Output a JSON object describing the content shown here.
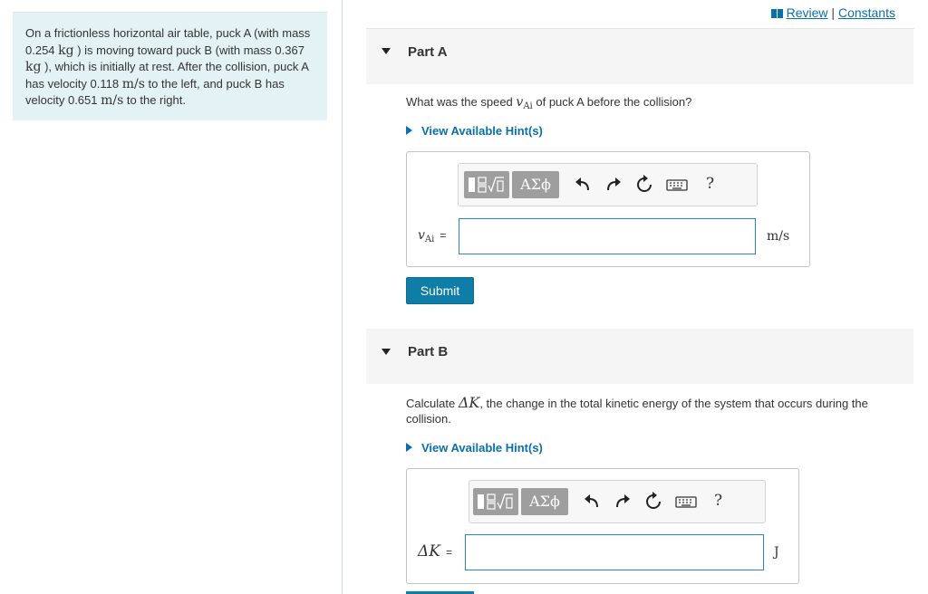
{
  "problem": {
    "text_1": "On a frictionless horizontal air table, puck A (with mass 0.254 ",
    "unit_kg_1": "kg",
    "text_2": " ) is moving toward puck B (with mass 0.367 ",
    "unit_kg_2": "kg",
    "text_3": " ), which is initially at rest. After the collision, puck A has velocity 0.118 ",
    "unit_ms_1": "m/s",
    "text_4": " to the left, and puck B has velocity 0.651 ",
    "unit_ms_2": "m/s",
    "text_5": " to the right."
  },
  "header": {
    "review_label": "Review",
    "separator": " | ",
    "constants_label": "Constants"
  },
  "part_a": {
    "title": "Part A",
    "question_pre": "What was the speed ",
    "question_var": "v",
    "question_sub": "Ai",
    "question_post": " of puck A before the collision?",
    "hint_label": "View Available Hint(s)",
    "greek_label": "ΑΣϕ",
    "help_label": "?",
    "var_main": "v",
    "var_sub": "Ai",
    "equals": "=",
    "input_value": "",
    "unit": "m/s",
    "submit_label": "Submit"
  },
  "part_b": {
    "title": "Part B",
    "question_pre": "Calculate ",
    "question_var": "ΔK",
    "question_post": ", the change in the total kinetic energy of the system that occurs during the collision.",
    "hint_label": "View Available Hint(s)",
    "greek_label": "ΑΣϕ",
    "help_label": "?",
    "var_main": "ΔK",
    "equals": "=",
    "input_value": "",
    "unit": "J"
  },
  "icons": [
    "triangle-down-icon",
    "play-arrow-icon",
    "templates-icon",
    "undo-icon",
    "redo-icon",
    "reset-icon",
    "keyboard-icon",
    "help-icon",
    "review-book-icon"
  ],
  "colors": {
    "accent": "#0f7ea6",
    "link": "#0a70a8",
    "problem_bg": "#e3f3f5",
    "input_border": "#2e86c1"
  }
}
